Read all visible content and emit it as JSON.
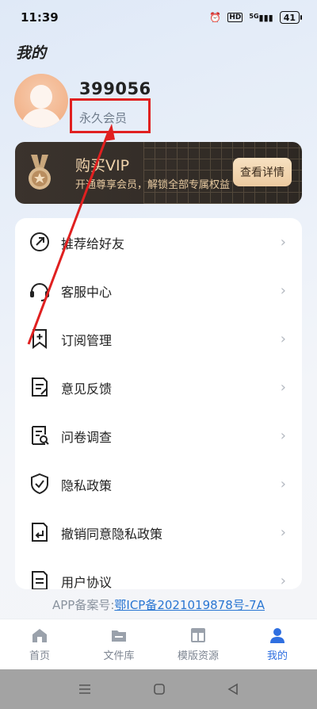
{
  "status_bar": {
    "time": "11:39",
    "battery": "41",
    "signal": "5G"
  },
  "page": {
    "title": "我的"
  },
  "user": {
    "id": "399056",
    "membership": "永久会员"
  },
  "vip": {
    "title": "购买VIP",
    "description": "开通尊享会员，解锁全部专属权益",
    "button": "查看详情"
  },
  "menu": [
    {
      "label": "推荐给好友",
      "icon": "share-icon"
    },
    {
      "label": "客服中心",
      "icon": "headset-icon"
    },
    {
      "label": "订阅管理",
      "icon": "bookmark-add-icon"
    },
    {
      "label": "意见反馈",
      "icon": "feedback-icon"
    },
    {
      "label": "问卷调查",
      "icon": "survey-icon"
    },
    {
      "label": "隐私政策",
      "icon": "shield-icon"
    },
    {
      "label": "撤销同意隐私政策",
      "icon": "revoke-icon"
    },
    {
      "label": "用户协议",
      "icon": "document-icon"
    }
  ],
  "icp": {
    "prefix": "APP备案号:",
    "number": "鄂ICP备2021019878号-7A"
  },
  "tabs": [
    {
      "label": "首页",
      "icon": "home-icon"
    },
    {
      "label": "文件库",
      "icon": "folder-icon"
    },
    {
      "label": "模版资源",
      "icon": "template-icon"
    },
    {
      "label": "我的",
      "icon": "user-icon"
    }
  ],
  "colors": {
    "accent": "#2f6fe0",
    "vip_gold": "#f1d4ac",
    "annotation_red": "#e02020"
  }
}
